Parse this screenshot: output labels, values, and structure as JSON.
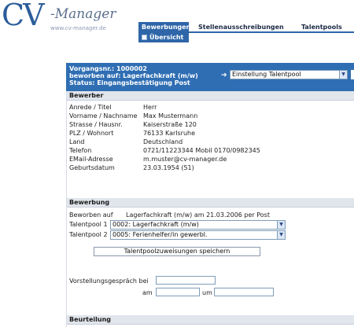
{
  "header": {
    "logo_cv": "CV",
    "logo_dash": "-Manager",
    "logo_url": "www.cv-manager.de",
    "tabs": [
      {
        "label": "Bewerbungen"
      },
      {
        "label": "Stellenausschreibungen"
      },
      {
        "label": "Talentpools"
      }
    ],
    "subnav": {
      "label": "Übersicht"
    }
  },
  "infobar": {
    "vorgang": "Vorgangsnr.: 1000002",
    "beworben": "beworben auf: Lagerfachkraft (m/w)",
    "status": "Status: Eingangsbestätigung Post",
    "action_select": "Einstellung Talentpool"
  },
  "bewerber": {
    "title": "Bewerber",
    "fields": [
      {
        "label": "Anrede / Titel",
        "value": "Herr"
      },
      {
        "label": "Vorname / Nachname",
        "value": "Max Mustermann"
      },
      {
        "label": "Strasse / Hausnr.",
        "value": "Kaiserstraße 120"
      },
      {
        "label": "PLZ / Wohnort",
        "value": "76133 Karlsruhe"
      },
      {
        "label": "Land",
        "value": "Deutschland"
      },
      {
        "label": "Telefon",
        "value": "0721/11223344 Mobil 0170/0982345"
      },
      {
        "label": "EMail-Adresse",
        "value": "m.muster@cv-manager.de"
      },
      {
        "label": "Geburtsdatum",
        "value": "23.03.1954 (51)"
      }
    ]
  },
  "bewerbung": {
    "title": "Bewerbung",
    "beworben_label": "Beworben auf",
    "beworben_value": "Lagerfachkraft (m/w) am 21.03.2006 per Post",
    "talentpool1_label": "Talentpool 1",
    "talentpool1_value": "0002: Lagerfachkraft (m/w)",
    "talentpool2_label": "Talentpool 2",
    "talentpool2_value": "0005: Ferienhelfer/in gewerbl.",
    "save_button": "Talentpoolzuweisungen speichern",
    "interview_label": "Vorstellungsgespräch bei",
    "am_label": "am",
    "um_label": "um"
  },
  "beurteilung": {
    "title": "Beurteilung"
  }
}
